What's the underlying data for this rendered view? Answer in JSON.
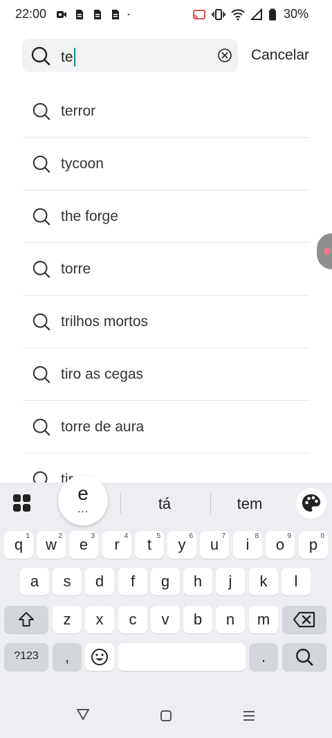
{
  "status_bar": {
    "time": "22:00",
    "battery": "30%",
    "left_icons": [
      "video-call-icon",
      "doc-icon",
      "doc-icon",
      "doc-icon",
      "dot-icon"
    ],
    "right_icons": [
      "cast-icon",
      "vibrate-icon",
      "wifi-icon",
      "signal-icon",
      "battery-icon"
    ]
  },
  "search": {
    "value": "te",
    "cancel_label": "Cancelar"
  },
  "suggestions": [
    "terror",
    "tycoon",
    "the forge",
    "torre",
    "trilhos mortos",
    "tiro as cegas",
    "torre de aura",
    "tir"
  ],
  "keyboard": {
    "bubble_letter": "e",
    "bubble_dots": "...",
    "suggestions": [
      "tá",
      "tem"
    ],
    "row1": [
      {
        "key": "q",
        "hint": "1"
      },
      {
        "key": "w",
        "hint": "2"
      },
      {
        "key": "e",
        "hint": "3"
      },
      {
        "key": "r",
        "hint": "4"
      },
      {
        "key": "t",
        "hint": "5"
      },
      {
        "key": "y",
        "hint": "6"
      },
      {
        "key": "u",
        "hint": "7"
      },
      {
        "key": "i",
        "hint": "8"
      },
      {
        "key": "o",
        "hint": "9"
      },
      {
        "key": "p",
        "hint": "0"
      }
    ],
    "row2": [
      "a",
      "s",
      "d",
      "f",
      "g",
      "h",
      "j",
      "k",
      "l"
    ],
    "row3": [
      "z",
      "x",
      "c",
      "v",
      "b",
      "n",
      "m"
    ],
    "symbols_label": "?123",
    "comma_label": ",",
    "period_label": "."
  }
}
